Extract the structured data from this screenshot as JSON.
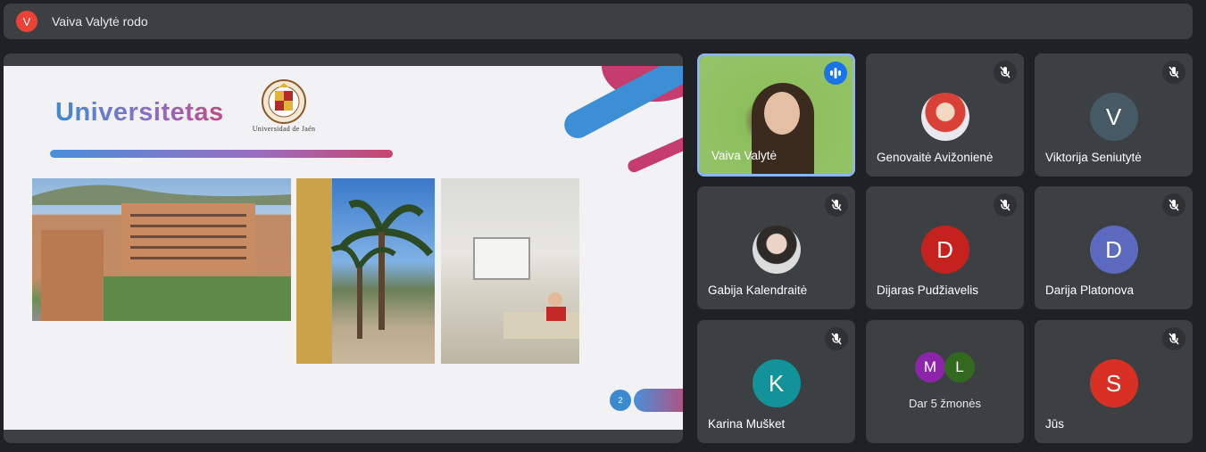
{
  "topbar": {
    "avatar_letter": "V",
    "presenting_text": "Vaiva Valytė rodo"
  },
  "slide": {
    "title": "Universitetas",
    "logo_caption": "Universidad de Jaén",
    "page_number": "2"
  },
  "participants": [
    {
      "name": "Vaiva Valytė",
      "status": "speaking"
    },
    {
      "name": "Genovaitė Avižonienė",
      "status": "muted"
    },
    {
      "name": "Viktorija Seniutytė",
      "letter": "V",
      "color": "#455a64",
      "status": "muted"
    },
    {
      "name": "Gabija Kalendraitė",
      "status": "muted"
    },
    {
      "name": "Dijaras Pudžiavelis",
      "letter": "D",
      "color": "#c5221f",
      "status": "muted"
    },
    {
      "name": "Darija Platonova",
      "letter": "D",
      "color": "#5c6bc0",
      "status": "muted"
    },
    {
      "name": "Karina Mušket",
      "letter": "K",
      "color": "#12939a",
      "status": "muted"
    },
    {
      "others_label": "Dar 5 žmonės",
      "letters": [
        "M",
        "L"
      ],
      "colors": [
        "#8e24aa",
        "#33691e"
      ]
    },
    {
      "name": "Jūs",
      "letter": "S",
      "color": "#d93025",
      "status": "muted"
    }
  ],
  "colors": {
    "background": "#202124",
    "tile": "#3c4043",
    "active_border": "#8ab4f8",
    "speaking": "#1a73e8"
  }
}
